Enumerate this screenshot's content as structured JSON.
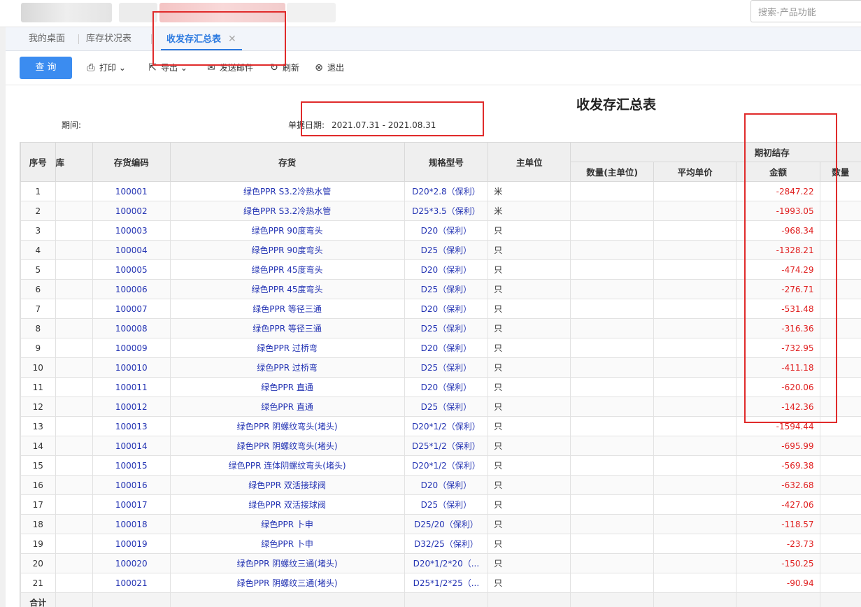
{
  "search": {
    "placeholder": "搜索-产品功能"
  },
  "tabs": [
    {
      "label": "我的桌面"
    },
    {
      "label": "库存状况表"
    },
    {
      "label": "收发存汇总表",
      "close": "✕"
    }
  ],
  "toolbar": {
    "query": "查 询",
    "print": "打印",
    "export": "导出",
    "email": "发送邮件",
    "refresh": "刷新",
    "exit": "退出"
  },
  "report": {
    "title": "收发存汇总表",
    "period_label": "期间:",
    "date_label": "单据日期:",
    "date_value": "2021.07.31 - 2021.08.31"
  },
  "table": {
    "headers": {
      "seq": "序号",
      "cut": "库",
      "code": "存货编码",
      "item": "存货",
      "spec": "规格型号",
      "unit": "主单位",
      "group": "期初结存",
      "qty": "数量(主单位)",
      "price": "平均单价",
      "amount": "金额",
      "qty2": "数量"
    },
    "total_label": "合计",
    "rows": [
      {
        "seq": "1",
        "code": "100001",
        "item": "绿色PPR S3.2冷热水管",
        "spec": "D20*2.8（保利）",
        "unit": "米",
        "amount": "-2847.22"
      },
      {
        "seq": "2",
        "code": "100002",
        "item": "绿色PPR S3.2冷热水管",
        "spec": "D25*3.5（保利）",
        "unit": "米",
        "amount": "-1993.05"
      },
      {
        "seq": "3",
        "code": "100003",
        "item": "绿色PPR 90度弯头",
        "spec": "D20（保利）",
        "unit": "只",
        "amount": "-968.34"
      },
      {
        "seq": "4",
        "code": "100004",
        "item": "绿色PPR 90度弯头",
        "spec": "D25（保利）",
        "unit": "只",
        "amount": "-1328.21"
      },
      {
        "seq": "5",
        "code": "100005",
        "item": "绿色PPR 45度弯头",
        "spec": "D20（保利）",
        "unit": "只",
        "amount": "-474.29"
      },
      {
        "seq": "6",
        "code": "100006",
        "item": "绿色PPR 45度弯头",
        "spec": "D25（保利）",
        "unit": "只",
        "amount": "-276.71"
      },
      {
        "seq": "7",
        "code": "100007",
        "item": "绿色PPR 等径三通",
        "spec": "D20（保利）",
        "unit": "只",
        "amount": "-531.48"
      },
      {
        "seq": "8",
        "code": "100008",
        "item": "绿色PPR 等径三通",
        "spec": "D25（保利）",
        "unit": "只",
        "amount": "-316.36"
      },
      {
        "seq": "9",
        "code": "100009",
        "item": "绿色PPR 过桥弯",
        "spec": "D20（保利）",
        "unit": "只",
        "amount": "-732.95"
      },
      {
        "seq": "10",
        "code": "100010",
        "item": "绿色PPR 过桥弯",
        "spec": "D25（保利）",
        "unit": "只",
        "amount": "-411.18"
      },
      {
        "seq": "11",
        "code": "100011",
        "item": "绿色PPR 直通",
        "spec": "D20（保利）",
        "unit": "只",
        "amount": "-620.06"
      },
      {
        "seq": "12",
        "code": "100012",
        "item": "绿色PPR 直通",
        "spec": "D25（保利）",
        "unit": "只",
        "amount": "-142.36"
      },
      {
        "seq": "13",
        "code": "100013",
        "item": "绿色PPR 阴螺纹弯头(堵头)",
        "spec": "D20*1/2（保利）",
        "unit": "只",
        "amount": "-1594.44"
      },
      {
        "seq": "14",
        "code": "100014",
        "item": "绿色PPR 阴螺纹弯头(堵头)",
        "spec": "D25*1/2（保利）",
        "unit": "只",
        "amount": "-695.99"
      },
      {
        "seq": "15",
        "code": "100015",
        "item": "绿色PPR 连体阴螺纹弯头(堵头)",
        "spec": "D20*1/2（保利）",
        "unit": "只",
        "amount": "-569.38"
      },
      {
        "seq": "16",
        "code": "100016",
        "item": "绿色PPR 双活接球阀",
        "spec": "D20（保利）",
        "unit": "只",
        "amount": "-632.68"
      },
      {
        "seq": "17",
        "code": "100017",
        "item": "绿色PPR 双活接球阀",
        "spec": "D25（保利）",
        "unit": "只",
        "amount": "-427.06"
      },
      {
        "seq": "18",
        "code": "100018",
        "item": "绿色PPR 卜申",
        "spec": "D25/20（保利）",
        "unit": "只",
        "amount": "-118.57"
      },
      {
        "seq": "19",
        "code": "100019",
        "item": "绿色PPR 卜申",
        "spec": "D32/25（保利）",
        "unit": "只",
        "amount": "-23.73"
      },
      {
        "seq": "20",
        "code": "100020",
        "item": "绿色PPR 阴螺纹三通(堵头)",
        "spec": "D20*1/2*20（...",
        "unit": "只",
        "amount": "-150.25"
      },
      {
        "seq": "21",
        "code": "100021",
        "item": "绿色PPR 阴螺纹三通(堵头)",
        "spec": "D25*1/2*25（...",
        "unit": "只",
        "amount": "-90.94"
      }
    ]
  },
  "colors": {
    "accent": "#3b8cf0",
    "link": "#2333b3",
    "negative": "#e02020",
    "highlight": "#e02b2b"
  }
}
